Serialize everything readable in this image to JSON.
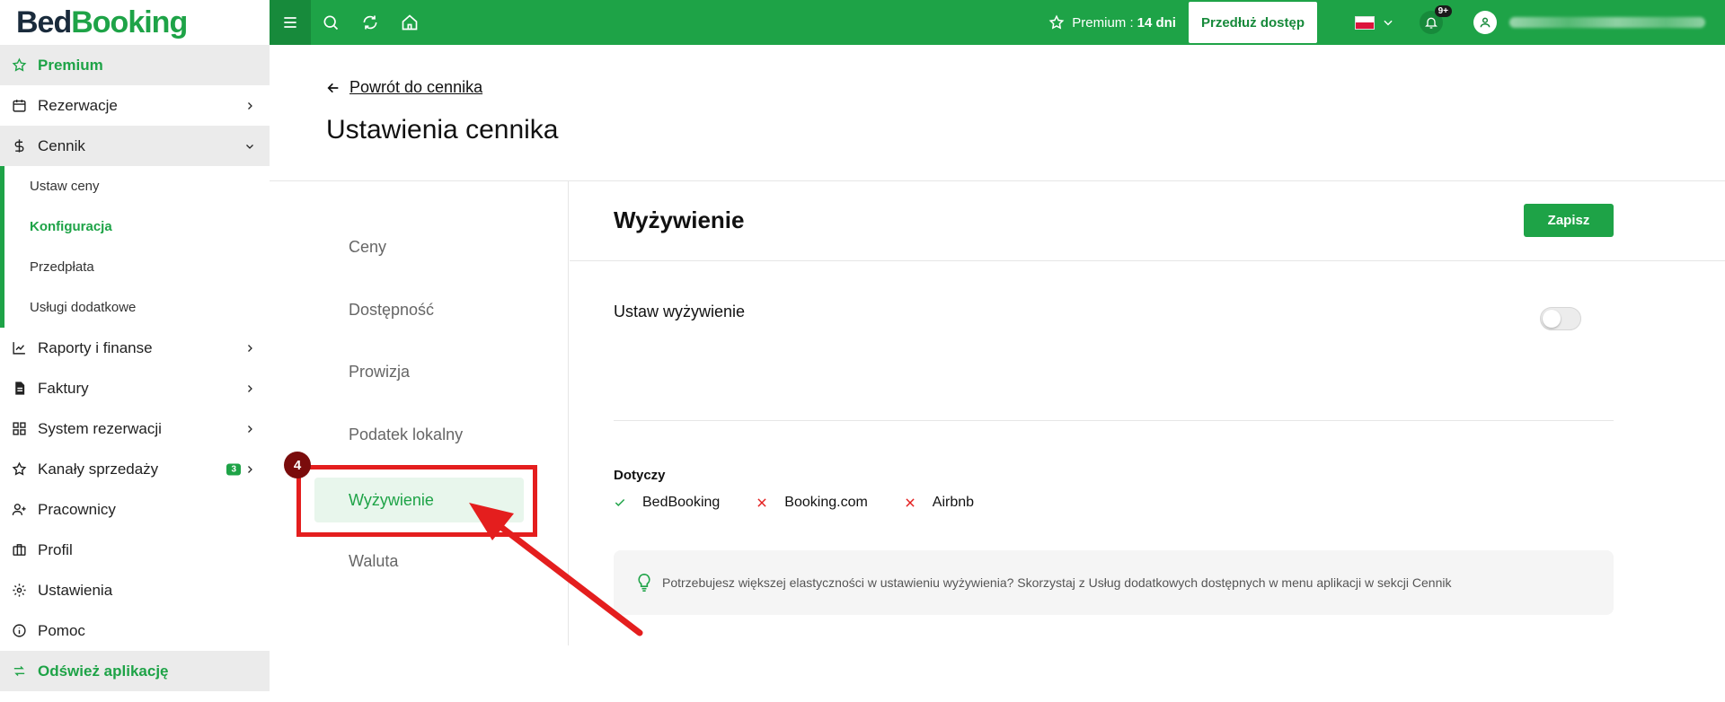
{
  "logo": {
    "part1": "Bed",
    "part2": "Booking"
  },
  "sidebar": {
    "premium": "Premium",
    "reservations": "Rezerwacje",
    "pricelist": "Cennik",
    "sub": [
      "Ustaw ceny",
      "Konfiguracja",
      "Przedpłata",
      "Usługi dodatkowe"
    ],
    "reports": "Raporty i finanse",
    "invoices": "Faktury",
    "booking_system": "System rezerwacji",
    "sales_channels": "Kanały sprzedaży",
    "sales_channels_badge": "3",
    "employees": "Pracownicy",
    "profile": "Profil",
    "settings": "Ustawienia",
    "help": "Pomoc",
    "refresh": "Odśwież aplikację"
  },
  "topbar": {
    "premium_label": "Premium :",
    "premium_days": "14 dni",
    "extend_button": "Przedłuż dostęp",
    "notifications": "9+"
  },
  "main": {
    "back_link": "Powrót do cennika",
    "title": "Ustawienia cennika",
    "left_nav": [
      "Ceny",
      "Dostępność",
      "Prowizja",
      "Podatek lokalny",
      "Wyżywienie",
      "Waluta"
    ],
    "active_index": 4
  },
  "content": {
    "title": "Wyżywienie",
    "save_button": "Zapisz",
    "meal_setting": "Ustaw wyżywienie",
    "applies_to": "Dotyczy",
    "channels": [
      {
        "name": "BedBooking",
        "enabled": true
      },
      {
        "name": "Booking.com",
        "enabled": false
      },
      {
        "name": "Airbnb",
        "enabled": false
      }
    ],
    "info": "Potrzebujesz większej elastyczności w ustawieniu wyżywienia? Skorzystaj z Usług dodatkowych dostępnych w menu aplikacji w sekcji Cennik"
  },
  "annotation": {
    "step": "4"
  },
  "colors": {
    "accent": "#1ea347",
    "accent_dark": "#178a3b",
    "annotation_red": "#e41e1e"
  }
}
